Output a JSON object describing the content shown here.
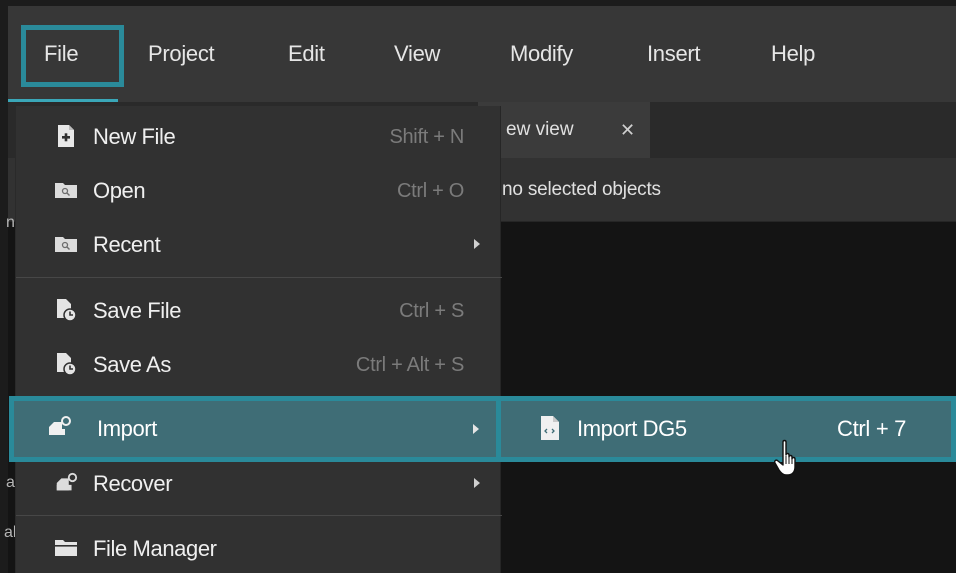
{
  "menubar": {
    "items": [
      {
        "label": "File"
      },
      {
        "label": "Project"
      },
      {
        "label": "Edit"
      },
      {
        "label": "View"
      },
      {
        "label": "Modify"
      },
      {
        "label": "Insert"
      },
      {
        "label": "Help"
      }
    ],
    "active": "File"
  },
  "editor": {
    "tab_label": "ew view",
    "tab_close": "✕",
    "status_text": "no selected objects",
    "side_peek": [
      "n",
      "a",
      "al"
    ]
  },
  "file_menu": {
    "items": [
      {
        "label": "New File",
        "shortcut": "Shift + N",
        "icon": "new-file-icon"
      },
      {
        "label": "Open",
        "shortcut": "Ctrl + O",
        "icon": "open-folder-icon"
      },
      {
        "label": "Recent",
        "shortcut": "",
        "icon": "recent-folder-icon",
        "submenu": true
      },
      {
        "label": "Save File",
        "shortcut": "Ctrl + S",
        "icon": "save-file-icon"
      },
      {
        "label": "Save As",
        "shortcut": "Ctrl + Alt + S",
        "icon": "save-as-icon"
      },
      {
        "label": "Import",
        "shortcut": "",
        "icon": "import-icon",
        "submenu": true,
        "highlighted": true
      },
      {
        "label": "Recover",
        "shortcut": "",
        "icon": "recover-icon",
        "submenu": true
      },
      {
        "label": "File Manager",
        "shortcut": "",
        "icon": "file-manager-icon"
      }
    ]
  },
  "import_submenu": {
    "items": [
      {
        "label": "Import DG5",
        "shortcut": "Ctrl + 7",
        "icon": "dg5-file-icon"
      }
    ]
  },
  "colors": {
    "highlight_border": "#2a8a9a",
    "highlight_fill": "#3f6d76",
    "menu_bg": "#313131",
    "menubar_bg": "#373737"
  }
}
